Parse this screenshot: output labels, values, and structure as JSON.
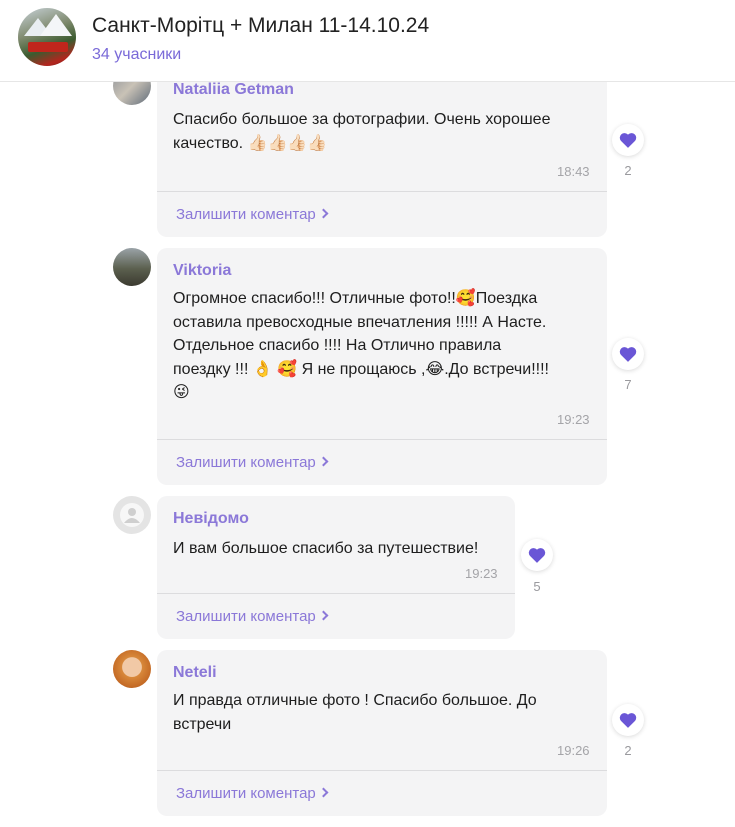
{
  "header": {
    "title": "Санкт-Морітц + Милан 11-14.10.24",
    "participants": "34 учасники"
  },
  "reply_label": "Залишити коментар",
  "messages": [
    {
      "author": "Nataliia Getman",
      "text": "Спасибо большое за фотографии. Очень хорошее\nкачество. 👍🏻👍🏻👍🏻👍🏻",
      "time": "18:43",
      "likes": "2"
    },
    {
      "author": "Viktoria",
      "text": "Огромное спасибо!!! Отличные фото!!🥰Поездка\nоставила превосходные  впечатления !!!!! А Насте.\nОтдельное спасибо !!!! На Отлично правила\nпоездку !!! 👌 🥰 Я не прощаюсь ,😂.До встречи!!!!\n😜",
      "time": "19:23",
      "likes": "7"
    },
    {
      "author": "Невідомо",
      "text": "И вам большое спасибо за путешествие!",
      "time": "19:23",
      "likes": "5"
    },
    {
      "author": "Neteli",
      "text": "И правда отличные фото ! Спасибо большое. До\nвстречи",
      "time": "19:26",
      "likes": "2"
    }
  ],
  "colors": {
    "accent": "#8b78d8",
    "heart": "#6a56d6",
    "bubble": "#f4f4f5"
  }
}
